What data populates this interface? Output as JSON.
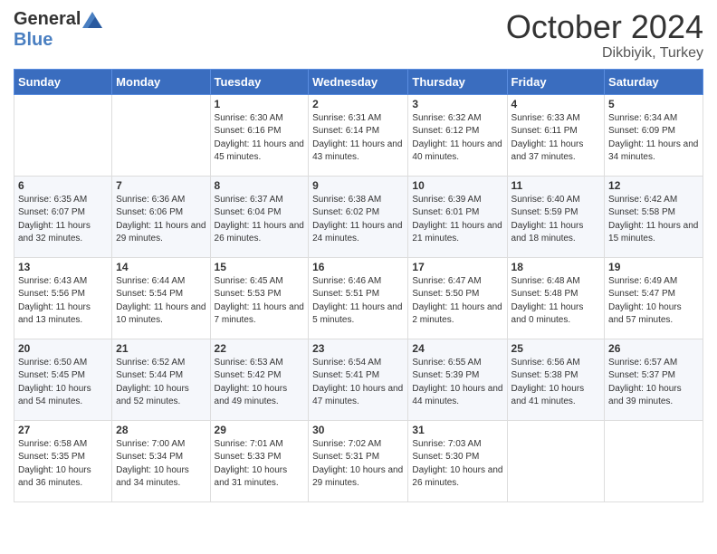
{
  "header": {
    "logo_general": "General",
    "logo_blue": "Blue",
    "month_title": "October 2024",
    "location": "Dikbiyik, Turkey"
  },
  "weekdays": [
    "Sunday",
    "Monday",
    "Tuesday",
    "Wednesday",
    "Thursday",
    "Friday",
    "Saturday"
  ],
  "weeks": [
    [
      {
        "day": "",
        "info": ""
      },
      {
        "day": "",
        "info": ""
      },
      {
        "day": "1",
        "info": "Sunrise: 6:30 AM\nSunset: 6:16 PM\nDaylight: 11 hours and 45 minutes."
      },
      {
        "day": "2",
        "info": "Sunrise: 6:31 AM\nSunset: 6:14 PM\nDaylight: 11 hours and 43 minutes."
      },
      {
        "day": "3",
        "info": "Sunrise: 6:32 AM\nSunset: 6:12 PM\nDaylight: 11 hours and 40 minutes."
      },
      {
        "day": "4",
        "info": "Sunrise: 6:33 AM\nSunset: 6:11 PM\nDaylight: 11 hours and 37 minutes."
      },
      {
        "day": "5",
        "info": "Sunrise: 6:34 AM\nSunset: 6:09 PM\nDaylight: 11 hours and 34 minutes."
      }
    ],
    [
      {
        "day": "6",
        "info": "Sunrise: 6:35 AM\nSunset: 6:07 PM\nDaylight: 11 hours and 32 minutes."
      },
      {
        "day": "7",
        "info": "Sunrise: 6:36 AM\nSunset: 6:06 PM\nDaylight: 11 hours and 29 minutes."
      },
      {
        "day": "8",
        "info": "Sunrise: 6:37 AM\nSunset: 6:04 PM\nDaylight: 11 hours and 26 minutes."
      },
      {
        "day": "9",
        "info": "Sunrise: 6:38 AM\nSunset: 6:02 PM\nDaylight: 11 hours and 24 minutes."
      },
      {
        "day": "10",
        "info": "Sunrise: 6:39 AM\nSunset: 6:01 PM\nDaylight: 11 hours and 21 minutes."
      },
      {
        "day": "11",
        "info": "Sunrise: 6:40 AM\nSunset: 5:59 PM\nDaylight: 11 hours and 18 minutes."
      },
      {
        "day": "12",
        "info": "Sunrise: 6:42 AM\nSunset: 5:58 PM\nDaylight: 11 hours and 15 minutes."
      }
    ],
    [
      {
        "day": "13",
        "info": "Sunrise: 6:43 AM\nSunset: 5:56 PM\nDaylight: 11 hours and 13 minutes."
      },
      {
        "day": "14",
        "info": "Sunrise: 6:44 AM\nSunset: 5:54 PM\nDaylight: 11 hours and 10 minutes."
      },
      {
        "day": "15",
        "info": "Sunrise: 6:45 AM\nSunset: 5:53 PM\nDaylight: 11 hours and 7 minutes."
      },
      {
        "day": "16",
        "info": "Sunrise: 6:46 AM\nSunset: 5:51 PM\nDaylight: 11 hours and 5 minutes."
      },
      {
        "day": "17",
        "info": "Sunrise: 6:47 AM\nSunset: 5:50 PM\nDaylight: 11 hours and 2 minutes."
      },
      {
        "day": "18",
        "info": "Sunrise: 6:48 AM\nSunset: 5:48 PM\nDaylight: 11 hours and 0 minutes."
      },
      {
        "day": "19",
        "info": "Sunrise: 6:49 AM\nSunset: 5:47 PM\nDaylight: 10 hours and 57 minutes."
      }
    ],
    [
      {
        "day": "20",
        "info": "Sunrise: 6:50 AM\nSunset: 5:45 PM\nDaylight: 10 hours and 54 minutes."
      },
      {
        "day": "21",
        "info": "Sunrise: 6:52 AM\nSunset: 5:44 PM\nDaylight: 10 hours and 52 minutes."
      },
      {
        "day": "22",
        "info": "Sunrise: 6:53 AM\nSunset: 5:42 PM\nDaylight: 10 hours and 49 minutes."
      },
      {
        "day": "23",
        "info": "Sunrise: 6:54 AM\nSunset: 5:41 PM\nDaylight: 10 hours and 47 minutes."
      },
      {
        "day": "24",
        "info": "Sunrise: 6:55 AM\nSunset: 5:39 PM\nDaylight: 10 hours and 44 minutes."
      },
      {
        "day": "25",
        "info": "Sunrise: 6:56 AM\nSunset: 5:38 PM\nDaylight: 10 hours and 41 minutes."
      },
      {
        "day": "26",
        "info": "Sunrise: 6:57 AM\nSunset: 5:37 PM\nDaylight: 10 hours and 39 minutes."
      }
    ],
    [
      {
        "day": "27",
        "info": "Sunrise: 6:58 AM\nSunset: 5:35 PM\nDaylight: 10 hours and 36 minutes."
      },
      {
        "day": "28",
        "info": "Sunrise: 7:00 AM\nSunset: 5:34 PM\nDaylight: 10 hours and 34 minutes."
      },
      {
        "day": "29",
        "info": "Sunrise: 7:01 AM\nSunset: 5:33 PM\nDaylight: 10 hours and 31 minutes."
      },
      {
        "day": "30",
        "info": "Sunrise: 7:02 AM\nSunset: 5:31 PM\nDaylight: 10 hours and 29 minutes."
      },
      {
        "day": "31",
        "info": "Sunrise: 7:03 AM\nSunset: 5:30 PM\nDaylight: 10 hours and 26 minutes."
      },
      {
        "day": "",
        "info": ""
      },
      {
        "day": "",
        "info": ""
      }
    ]
  ]
}
